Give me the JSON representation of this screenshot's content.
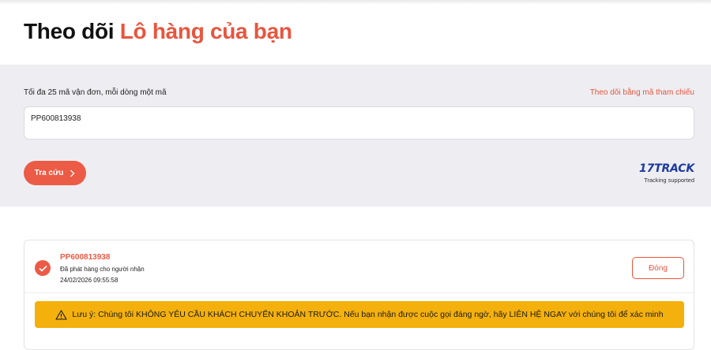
{
  "header": {
    "title_plain": "Theo dõi",
    "title_accent": "Lô hàng của bạn"
  },
  "search": {
    "hint": "Tối đa 25 mã vận đơn, mỗi dòng một mã",
    "ref_link": "Theo dõi bằng mã tham chiếu",
    "input_value": "PP600813938",
    "button_label": "Tra cứu",
    "partner_logo": "17TRACK",
    "partner_sub": "Tracking supported"
  },
  "result": {
    "tracking_number": "PP600813938",
    "status": "Đã phát hàng cho người nhận",
    "timestamp": "24/02/2026 09:55:58",
    "close_label": "Đóng",
    "status_icon": "check-circle-icon"
  },
  "warning": {
    "icon": "warning-triangle-icon",
    "text": "Lưu ý: Chúng tôi KHÔNG YÊU CẦU KHÁCH CHUYỂN KHOẢN TRƯỚC. Nếu bạn nhận được cuộc gọi đáng ngờ, hãy LIÊN HỆ NGAY với chúng tôi để xác minh"
  },
  "colors": {
    "accent": "#ec5b45",
    "warning_bg": "#f4b00c",
    "panel_bg": "#eeeef2",
    "logo_blue": "#1f3aa0"
  }
}
